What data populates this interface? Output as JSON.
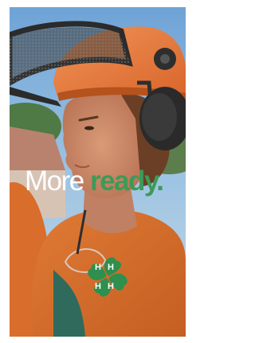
{
  "ad": {
    "headline_part1": "More ",
    "headline_part2": "ready.",
    "emblem_letter": "H",
    "colors": {
      "headline_white": "#ffffff",
      "headline_accent": "#3d9a58",
      "emblem_green": "#2f8f4e",
      "emblem_letter": "#ffffff",
      "frame_border": "#ffffff"
    },
    "emblem_icon": "four-leaf-clover-icon"
  }
}
